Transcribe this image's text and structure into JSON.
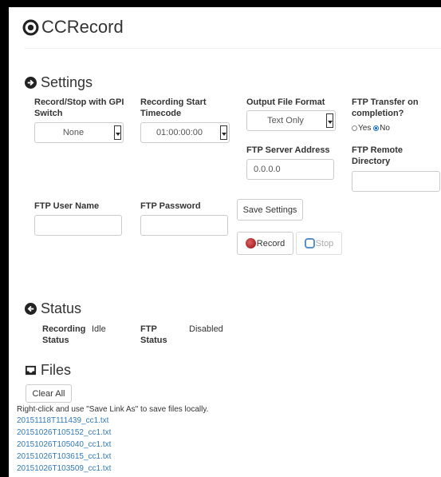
{
  "app": {
    "title": "CCRecord"
  },
  "settings": {
    "title": "Settings",
    "gpi": {
      "label": "Record/Stop with GPI Switch",
      "value": "None"
    },
    "timecode": {
      "label": "Recording Start Timecode",
      "value": "01:00:00:00"
    },
    "format": {
      "label": "Output File Format",
      "value": "Text Only"
    },
    "ftp_transfer": {
      "label": "FTP Transfer on completion?",
      "yes": "Yes",
      "no": "No",
      "selected": "No"
    },
    "ftp_server": {
      "label": "FTP Server Address",
      "value": "0.0.0.0"
    },
    "ftp_dir": {
      "label": "FTP Remote Directory",
      "value": ""
    },
    "ftp_user": {
      "label": "FTP User Name",
      "value": ""
    },
    "ftp_pass": {
      "label": "FTP Password",
      "value": ""
    },
    "save_label": "Save Settings",
    "record_label": "Record",
    "stop_label": "Stop",
    "colors": {
      "record": "#c0392b",
      "stop": "#5b8fc7"
    }
  },
  "status": {
    "title": "Status",
    "recording_label": "Recording Status",
    "recording_value": "Idle",
    "ftp_label": "FTP Status",
    "ftp_value": "Disabled"
  },
  "files": {
    "title": "Files",
    "clear_label": "Clear All",
    "hint": "Right-click and use \"Save Link As\" to save files locally.",
    "items": [
      "20151118T111439_cc1.txt",
      "20151026T105152_cc1.txt",
      "20151026T105040_cc1.txt",
      "20151026T103615_cc1.txt",
      "20151026T103509_cc1.txt"
    ]
  }
}
